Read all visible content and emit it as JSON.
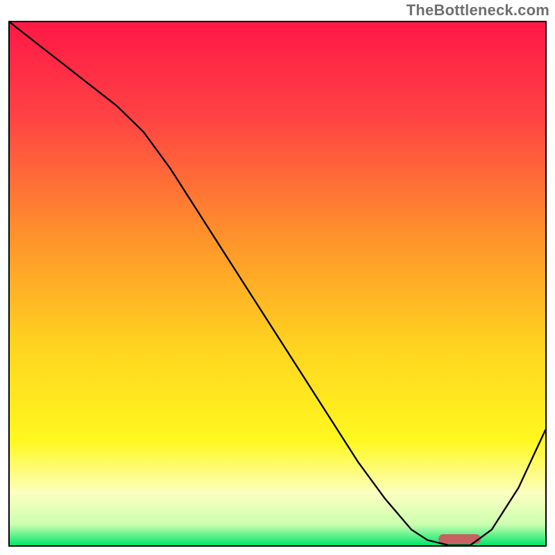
{
  "watermark": "TheBottleneck.com",
  "colors": {
    "gradient_stops": [
      {
        "offset": "0%",
        "color": "#ff1846"
      },
      {
        "offset": "18%",
        "color": "#ff4244"
      },
      {
        "offset": "40%",
        "color": "#ff8f2c"
      },
      {
        "offset": "62%",
        "color": "#ffd41f"
      },
      {
        "offset": "80%",
        "color": "#fff81f"
      },
      {
        "offset": "90%",
        "color": "#fcffc0"
      },
      {
        "offset": "96%",
        "color": "#ccffb0"
      },
      {
        "offset": "100%",
        "color": "#00e56a"
      }
    ],
    "marker": "#c76262",
    "line": "#000000"
  },
  "chart_data": {
    "type": "line",
    "title": "",
    "xlabel": "",
    "ylabel": "",
    "xlim": [
      0,
      100
    ],
    "ylim": [
      0,
      100
    ],
    "x": [
      0,
      5,
      10,
      15,
      20,
      25,
      30,
      35,
      40,
      45,
      50,
      55,
      60,
      65,
      70,
      75,
      78,
      82,
      86,
      90,
      95,
      100
    ],
    "values": [
      100,
      96,
      92,
      88,
      84,
      79,
      72,
      64,
      56,
      48,
      40,
      32,
      24,
      16,
      9,
      3,
      1,
      0,
      0,
      3,
      11,
      22
    ],
    "marker": {
      "x_start": 80,
      "x_end": 88,
      "y": 0
    },
    "note": "Axes implied 0–100; values read off relative pixel positions."
  }
}
